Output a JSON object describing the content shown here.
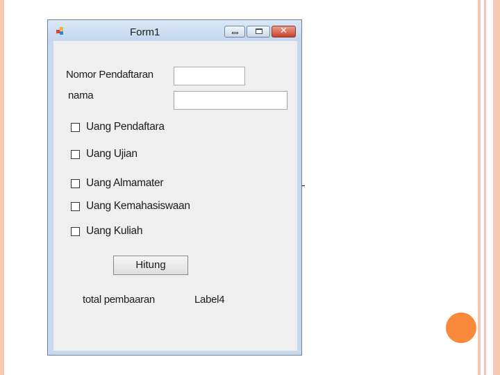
{
  "window": {
    "title": "Form1",
    "close_glyph": "✕"
  },
  "form": {
    "nomor_label": "Nomor Pendaftaran",
    "nomor_value": "",
    "nama_label": "nama",
    "nama_value": "",
    "checkboxes": [
      {
        "label": "Uang Pendaftara",
        "checked": false
      },
      {
        "label": "Uang Ujian",
        "checked": false
      },
      {
        "label": "Uang Almamater",
        "checked": false
      },
      {
        "label": "Uang Kemahasiswaan",
        "checked": false
      },
      {
        "label": "Uang Kuliah",
        "checked": false
      }
    ],
    "hitung_button": "Hitung",
    "total_label": "total pembaaran",
    "result_label": "Label4"
  }
}
